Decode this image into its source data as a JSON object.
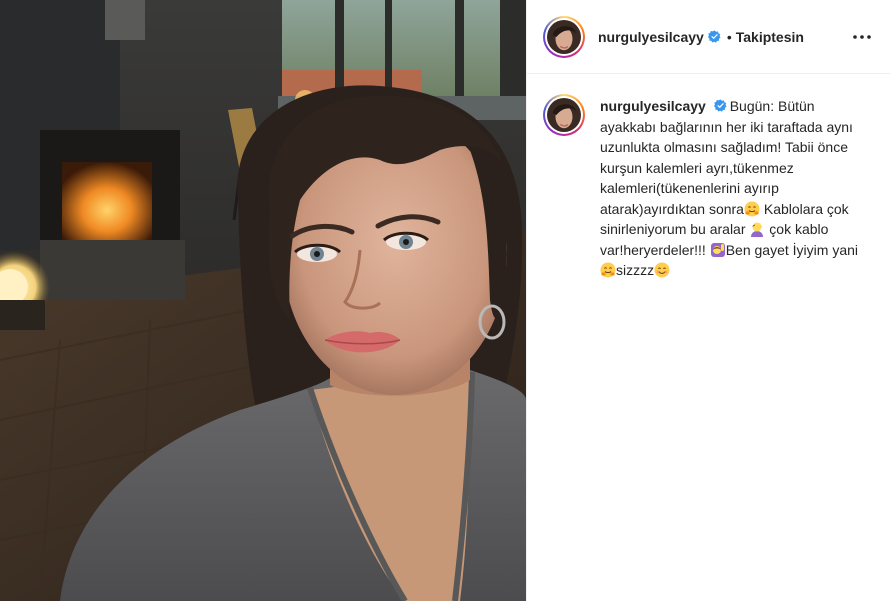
{
  "post": {
    "author": {
      "username": "nurgulyesilcayy",
      "verified": true,
      "verified_icon": "verified-badge-icon"
    },
    "header": {
      "separator": "•",
      "follow_status": "Takiptesin",
      "more_icon": "more-options-icon"
    },
    "caption": {
      "username": "nurgulyesilcayy",
      "segments": [
        "Bugün: Bütün ayakkabı bağlarının her iki taraftada aynı uzunlukta olmasını sağladım! Tabii önce kurşun kalemleri ayrı,tükenmez kalemleri(tükenenlerini ayırıp atarak)ayırdıktan sonra",
        " Kablolara çok sinirleniyorum bu aralar ",
        " çok kablo var!heryerdeler!!! ",
        "Ben gayet İyiyim yani",
        "sizzzz"
      ],
      "emojis": [
        "hugging-face-emoji",
        "woman-facepalming-emoji",
        "woman-raising-hand-emoji",
        "hugging-face-emoji",
        "smiling-face-emoji"
      ]
    },
    "photo": {
      "subject": "selfie-photo"
    },
    "colors": {
      "verified_blue": "#3897f0",
      "text": "#262626",
      "border": "#efefef"
    }
  }
}
